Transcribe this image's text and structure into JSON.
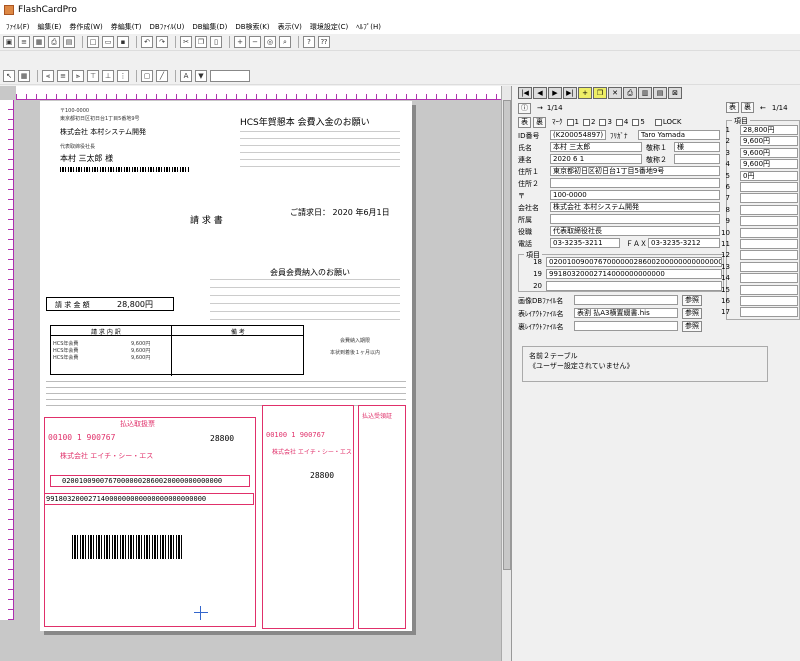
{
  "window": {
    "title": "FlashCardPro"
  },
  "menu": [
    "ﾌｧｲﾙ(F)",
    "編集(E)",
    "券作成(W)",
    "券編集(T)",
    "DBﾌｧｲﾙ(U)",
    "DB編集(D)",
    "DB検索(K)",
    "表示(V)",
    "環境設定(C)",
    "ﾍﾙﾌﾟ(H)"
  ],
  "toolbar2": {
    "zoom_value": ""
  },
  "record": {
    "page": "1/14",
    "front_label": "表",
    "back_label": "裏",
    "mark_label": "ﾏｰｸ",
    "checks": [
      "1",
      "2",
      "3",
      "4",
      "5"
    ],
    "lock_label": "LOCK",
    "fields": [
      {
        "label": "ID番号",
        "value": "(K200054897)"
      },
      {
        "label": "ﾌﾘｶﾞﾅ",
        "value": "Taro Yamada"
      },
      {
        "label": "氏名",
        "value": "本村 三太郎"
      },
      {
        "label": "敬称１",
        "value": "様"
      },
      {
        "label": "連名",
        "value": "2020  6  1"
      },
      {
        "label": "敬称２",
        "value": ""
      },
      {
        "label": "住所１",
        "value": "東京都初日区初日台1丁目5番地9号"
      },
      {
        "label": "住所２",
        "value": ""
      },
      {
        "label": "〒",
        "value": "100-0000"
      },
      {
        "label": "会社名",
        "value": "株式会社 本村システム開発"
      },
      {
        "label": "所属",
        "value": ""
      },
      {
        "label": "役職",
        "value": "代表取締役社長"
      },
      {
        "label": "電話",
        "value": "03-3235-3211"
      },
      {
        "label": "ＦＡＸ",
        "value": "03-3235-3212"
      }
    ],
    "items_label": "項目",
    "items": [
      {
        "no": "18",
        "value": "0200100900767000000286002000000000000000"
      },
      {
        "no": "19",
        "value": "99180320002714000000000000"
      },
      {
        "no": "20",
        "value": ""
      }
    ],
    "files": [
      {
        "label": "画像DBﾌｧｲﾙ名",
        "value": "",
        "btn": "参照"
      },
      {
        "label": "表ﾚｲｱｳﾄﾌｧｲﾙ名",
        "value": "表割 払A3横置綴書.his",
        "btn": "参照"
      },
      {
        "label": "裏ﾚｲｱｳﾄﾌｧｲﾙ名",
        "value": "",
        "btn": "参照"
      }
    ],
    "table2": {
      "title": "名前２テーブル",
      "note": "《ユーザー設定されていません》"
    }
  },
  "rightcol": {
    "front_label": "表",
    "back_label": "裏",
    "page": "1/14",
    "items_label": "項目",
    "values": [
      "28,800円",
      "9,600円",
      "9,600円",
      "9,600円",
      "0円",
      "",
      "",
      "",
      "",
      "",
      "",
      "",
      "",
      "",
      "",
      "",
      ""
    ]
  },
  "doc": {
    "addr1": "〒100-0000",
    "addr2": "東京都初日区初日台1丁目5番地9号",
    "company": "株式会社 本村システム開発",
    "role": "代表取締役社長",
    "name": "本村  三太郎  様",
    "notice_title": "HCS年賀懇本 会費入金のお願い",
    "invoice_title": "請 求 書",
    "date": "ご請求日： 2020 年6月1日",
    "pay_title": "会員会費納入のお願い",
    "amount_label": "請 求 金 額",
    "amount": "28,800円",
    "th_detail": "請 求 内 訳",
    "th_note": "備 考",
    "rows": [
      {
        "name": "HCS年会費",
        "val": "9,600円"
      },
      {
        "name": "HCS年会費",
        "val": "9,600円"
      },
      {
        "name": "HCS年会費",
        "val": "9,600円"
      }
    ],
    "deadline_label": "会費納入期限",
    "deadline": "本状到着後１ヶ月以内",
    "slip_title": "払込取扱票",
    "slip_company": "株式会社 エイチ・シー・エス",
    "acct": "00100 1 900767",
    "amount_digits": "28800",
    "ocr1": "02001009007670000002860020000000000000",
    "ocr2": "99180320002714000000000000000000000000",
    "receipt_title": "払込受領証"
  },
  "colors": {
    "accent": "#e0306a",
    "ruler": "#b030b0"
  }
}
